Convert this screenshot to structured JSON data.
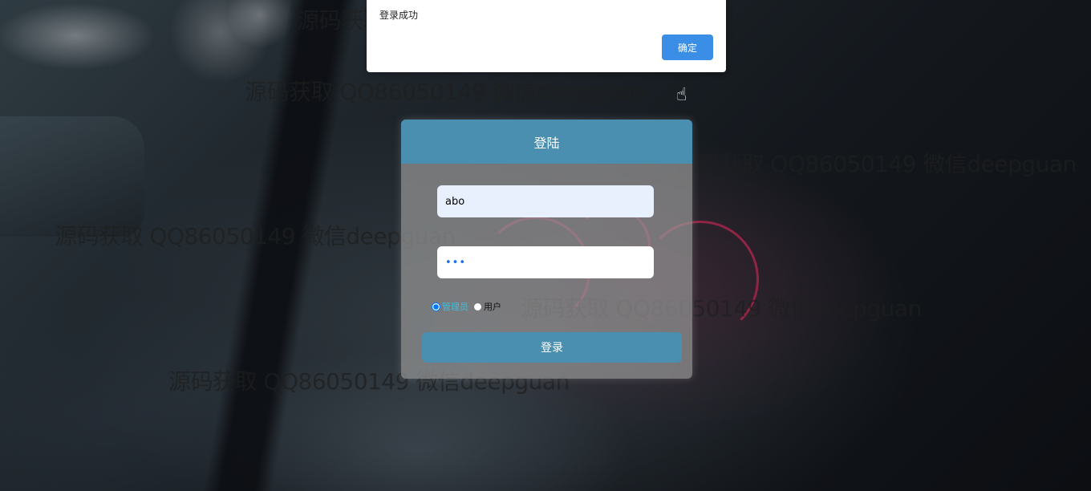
{
  "alert": {
    "message": "登录成功",
    "ok_label": "确定"
  },
  "login": {
    "title": "登陆",
    "username_value": "abo",
    "password_value": "•••",
    "roles": [
      {
        "label": "管理员",
        "selected": true
      },
      {
        "label": "用户",
        "selected": false
      }
    ],
    "submit_label": "登录"
  },
  "watermark_text": "源码获取 QQ86050149 微信deepguan",
  "colors": {
    "accent": "#4a8fb0",
    "ok_button": "#3b8ee6",
    "admin_label": "#3bbfe0"
  }
}
